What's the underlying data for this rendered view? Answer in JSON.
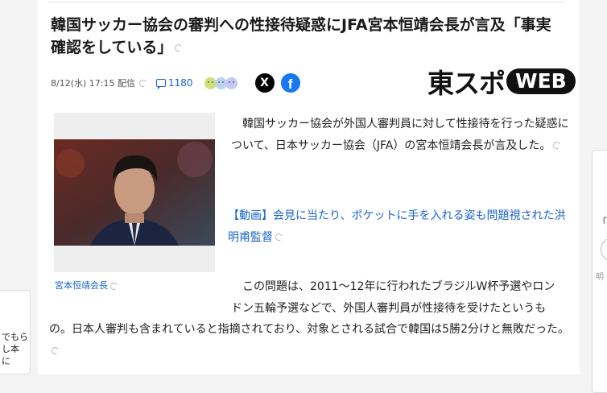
{
  "article": {
    "title": "韓国サッカー協会の審判への性接待疑惑にJFA宮本恒靖会長が言及「事実確認をしている」",
    "date": "8/12(水) 17:15 配信",
    "comment_count": "1180",
    "share_x": "X",
    "share_facebook": "f",
    "publisher_logo_jp": "東スポ",
    "publisher_logo_web": "WEB",
    "image_caption": "宮本恒靖会長",
    "paragraph1": "韓国サッカー協会が外国人審判員に対して性接待を行った疑惑について、日本サッカー協会（JFA）の宮本恒靖会長が言及した。",
    "related_link": "【動画】会見に当たり、ポケットに手を入れる姿も問題視された洪明甫監督",
    "paragraph2_line1": "この問題は、2011～12年に行われたブラジルW杯予選やロン",
    "paragraph2_line2": "ドン五輪予選などで、外国人審判員が性接待を受けたというも",
    "paragraph2_rest": "の。日本人審判も含まれていると指摘されており、対象とされる試合で韓国は5勝2分けと無敗だった。"
  },
  "left_card": {
    "lines": [
      "でもら",
      "し本",
      "に"
    ]
  },
  "right_panel": {
    "quote_char": "「",
    "subtext": "明"
  },
  "colors": {
    "link": "#1a64c8",
    "x_brand": "#000000",
    "facebook_brand": "#1877f2"
  },
  "icons": [
    "comment-icon",
    "reaction-faces-icon",
    "x-share-icon",
    "facebook-share-icon",
    "translate-icon"
  ]
}
